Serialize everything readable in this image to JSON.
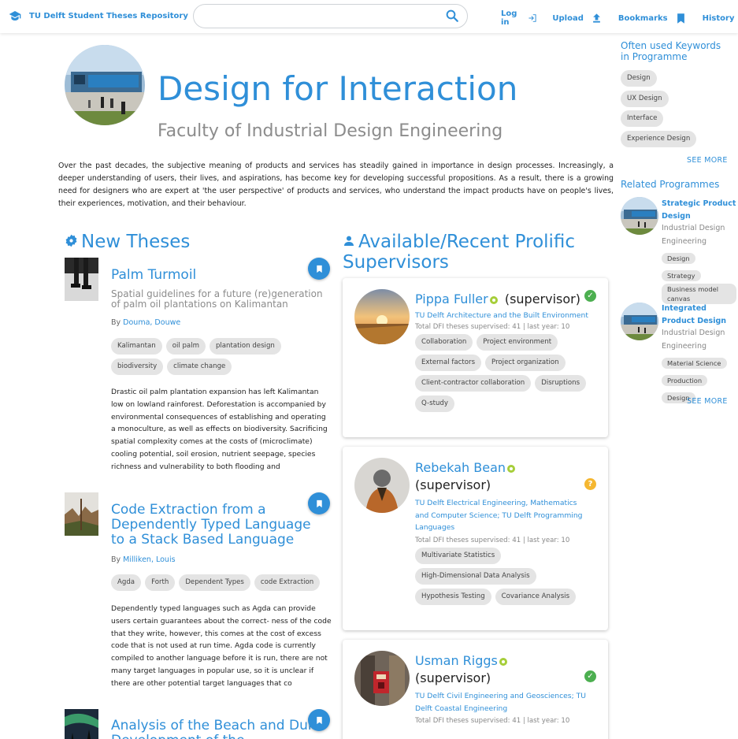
{
  "header": {
    "brand": "TU Delft Student Theses Repository",
    "search_placeholder": "",
    "login": "Log in",
    "upload": "Upload",
    "bookmarks": "Bookmarks",
    "history": "History"
  },
  "hero": {
    "title": "Design for Interaction",
    "subtitle": "Faculty of Industrial Design Engineering",
    "intro": "Over the past decades, the subjective meaning of products and services has steadily gained in importance in design processes. Increasingly, a deeper understanding of users, their lives, and aspirations, has become key for developing successful propositions. As a result, there is a growing need for designers who are expert at 'the user perspective' of products and services, who understand the impact products have on people's lives, their experiences, motivation, and their behaviour."
  },
  "new_theses": {
    "heading": "New Theses",
    "items": [
      {
        "title": "Palm Turmoil",
        "subtitle": "Spatial guidelines for a future (re)generation of palm oil plantations on Kalimantan",
        "by": "By",
        "author": "Douma, Douwe",
        "tags": [
          "Kalimantan",
          "oil palm",
          "plantation design",
          "biodiversity",
          "climate change"
        ],
        "abstract": "Drastic oil palm plantation expansion has left Kalimantan low on lowland rainforest. Deforestation is accompanied by environmental consequences of establishing and operating a monoculture, as well as effects on biodiversity. Sacrificing spatial complexity comes at the costs of (microclimate) cooling potential, soil erosion, nutrient seepage, species richness and vulnerability to both flooding and"
      },
      {
        "title": "Code Extraction from a Dependently Typed Language to a Stack Based Language",
        "by": "By",
        "author": "Milliken, Louis",
        "tags": [
          "Agda",
          "Forth",
          "Dependent Types",
          "code Extraction"
        ],
        "abstract": "Dependently typed languages such as Agda can provide users certain guarantees about the correct- ness of the code that they write, however, this comes at the cost of excess code that is not used at run time. Agda code is currently compiled to another language before it is run, there are not many target languages in popular use, so it is unclear if there are other potential target languages that co"
      },
      {
        "title": "Analysis of the Beach and Dune Development of the"
      }
    ]
  },
  "supervisors": {
    "heading": "Available/Recent Prolific Supervisors",
    "items": [
      {
        "name": "Pippa Fuller",
        "role": "(supervisor)",
        "affiliation": "TU Delft Architecture and the Built Environment",
        "stats": "Total DFI theses supervised: 41 | last year: 10",
        "tags": [
          "Collaboration",
          "Project environment",
          "External factors",
          "Project organization",
          "Client-contractor collaboration",
          "Disruptions",
          "Q-study"
        ],
        "status": "available",
        "status_color": "#4caf50"
      },
      {
        "name": "Rebekah Bean",
        "role": "(supervisor)",
        "affiliation": "TU Delft Electrical Engineering, Mathematics and Computer Science; TU Delft Programming Languages",
        "stats": "Total DFI theses supervised: 41 | last year: 10",
        "tags": [
          "Multivariate Statistics",
          "High-Dimensional Data Analysis",
          "Hypothesis Testing",
          "Covariance Analysis"
        ],
        "status": "unknown",
        "status_color": "#f5b731"
      },
      {
        "name": "Usman Riggs",
        "role": "(supervisor)",
        "affiliation": "TU Delft Civil Engineering and Geosciences; TU Delft Coastal Engineering",
        "stats": "Total DFI theses supervised: 41 | last year: 10",
        "status": "available",
        "status_color": "#4caf50"
      }
    ]
  },
  "sidebar": {
    "keywords_heading": "Often used Keywords in Programme",
    "keywords": [
      "Design",
      "UX Design",
      "Interface",
      "Experience Design"
    ],
    "see_more": "SEE MORE",
    "related_heading": "Related Programmes",
    "related": [
      {
        "title": "Strategic Product Design",
        "faculty": "Industrial Design Engineering",
        "tags": [
          "Design",
          "Strategy",
          "Business model canvas"
        ]
      },
      {
        "title": "Integrated Product Design",
        "faculty": "Industrial Design Engineering",
        "tags": [
          "Material Science",
          "Production",
          "Design"
        ]
      }
    ],
    "see_more_2": "SEE MORE"
  },
  "colors": {
    "accent": "#2f8fd8",
    "chip": "#e4e4e4",
    "orcid": "#a6ce39"
  }
}
